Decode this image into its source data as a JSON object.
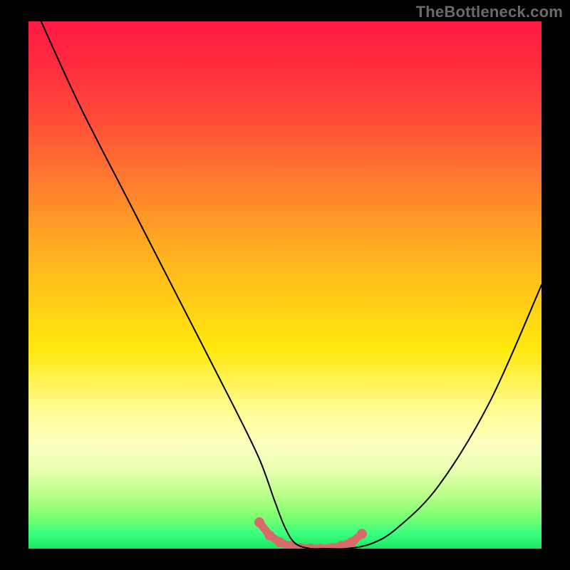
{
  "watermark": "TheBottleneck.com",
  "chart_data": {
    "type": "line",
    "title": "",
    "xlabel": "",
    "ylabel": "",
    "xlim": [
      0,
      100
    ],
    "ylim": [
      0,
      100
    ],
    "series": [
      {
        "name": "curve",
        "x": [
          2,
          10,
          20,
          30,
          40,
          45,
          48,
          50,
          52,
          55,
          58,
          62,
          67,
          72,
          80,
          90,
          100
        ],
        "values": [
          101,
          84,
          65,
          46,
          27,
          17,
          9,
          4,
          1,
          0,
          0,
          0,
          1,
          4,
          12,
          28,
          50
        ]
      }
    ],
    "markers": {
      "name": "highlight",
      "x": [
        45,
        47,
        49,
        51,
        53,
        55,
        57,
        59,
        61,
        63,
        65
      ],
      "values": [
        5,
        2.5,
        1.2,
        0.5,
        0.1,
        0,
        0,
        0.1,
        0.5,
        1.2,
        2.8
      ]
    },
    "colors": {
      "curve": "#000000",
      "marker": "#d96a6a",
      "background_gradient": [
        "#ff1a44",
        "#ffe80c",
        "#18e860"
      ]
    }
  }
}
